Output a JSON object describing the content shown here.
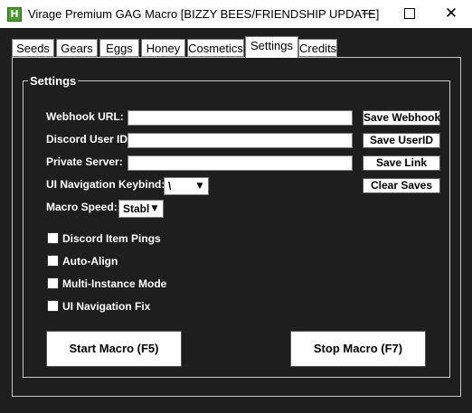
{
  "window": {
    "title": "Virage Premium GAG Macro [BIZZY BEES/FRIENDSHIP UPDATE]",
    "icon": "app-icon",
    "controls": {
      "minimize": "—",
      "close": "✕"
    }
  },
  "tabs": [
    {
      "label": "Seeds",
      "active": false
    },
    {
      "label": "Gears",
      "active": false
    },
    {
      "label": "Eggs",
      "active": false
    },
    {
      "label": "Honey",
      "active": false
    },
    {
      "label": "Cosmetics",
      "active": false
    },
    {
      "label": "Settings",
      "active": true
    },
    {
      "label": "Credits",
      "active": false
    }
  ],
  "settings": {
    "group_title": "Settings",
    "webhook": {
      "label": "Webhook URL:",
      "value": "",
      "button": "Save Webhook"
    },
    "user_id": {
      "label": "Discord User ID:",
      "value": "",
      "button": "Save UserID"
    },
    "private_server": {
      "label": "Private Server:",
      "value": "",
      "button": "Save Link"
    },
    "clear_saves": "Clear Saves",
    "keybind": {
      "label": "UI Navigation Keybind:",
      "value": "\\"
    },
    "macro_speed": {
      "label": "Macro Speed:",
      "value": "Stabl"
    },
    "checkboxes": [
      {
        "label": "Discord Item Pings",
        "checked": false
      },
      {
        "label": "Auto-Align",
        "checked": false
      },
      {
        "label": "Multi-Instance Mode",
        "checked": false
      },
      {
        "label": "UI Navigation Fix",
        "checked": false
      }
    ],
    "start_button": "Start Macro (F5)",
    "stop_button": "Stop Macro (F7)"
  }
}
